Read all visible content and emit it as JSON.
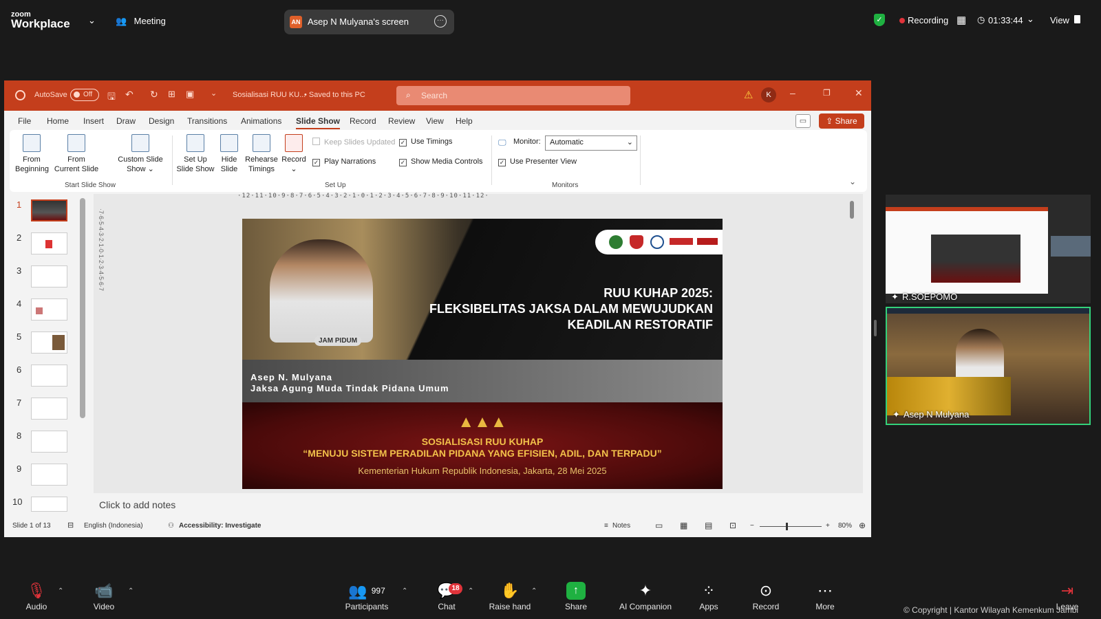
{
  "zoom": {
    "logo_line1": "zoom",
    "logo_line2": "Workplace",
    "meeting_label": "Meeting",
    "screen_share_initials": "AN",
    "screen_share_label": "Asep N Mulyana's screen",
    "recording_label": "Recording",
    "timer": "01:33:44",
    "view_label": "View",
    "accent_green": "#1fb141",
    "record_red": "#e0333a"
  },
  "ppt": {
    "autosave_label": "AutoSave",
    "autosave_state": "Off",
    "file_name": "Sosialisasi RUU KU...",
    "saved_state": "• Saved to this PC",
    "search_placeholder": "Search",
    "user_initial": "K",
    "share_label": "Share",
    "tabs": [
      "File",
      "Home",
      "Insert",
      "Draw",
      "Design",
      "Transitions",
      "Animations",
      "Slide Show",
      "Record",
      "Review",
      "View",
      "Help"
    ],
    "active_tab": "Slide Show",
    "ribbon": {
      "from_beginning": [
        "From",
        "Beginning"
      ],
      "from_current": [
        "From",
        "Current Slide"
      ],
      "custom_show": [
        "Custom Slide",
        "Show"
      ],
      "setup_show": [
        "Set Up",
        "Slide Show"
      ],
      "hide_slide": [
        "Hide",
        "Slide"
      ],
      "rehearse": [
        "Rehearse",
        "Timings"
      ],
      "record": "Record",
      "keep_slides_updated": "Keep Slides Updated",
      "use_timings": "Use Timings",
      "play_narrations": "Play Narrations",
      "show_media_controls": "Show Media Controls",
      "monitor_label": "Monitor:",
      "monitor_value": "Automatic",
      "use_presenter_view": "Use Presenter View",
      "group_start": "Start Slide Show",
      "group_setup": "Set Up",
      "group_monitors": "Monitors"
    },
    "thumbnail_numbers": [
      "1",
      "2",
      "3",
      "4",
      "5",
      "6",
      "7",
      "8",
      "9",
      "10"
    ],
    "ruler_text": "·12·11·10·9·8·7·6·5·4·3·2·1·0·1·2·3·4·5·6·7·8·9·10·11·12·",
    "notes_placeholder": "Click to add notes",
    "status": {
      "slide_counter": "Slide 1 of 13",
      "language": "English (Indonesia)",
      "accessibility": "Accessibility: Investigate",
      "notes_label": "Notes",
      "zoom_level": "80%"
    }
  },
  "slide": {
    "badge": "JAM PIDUM",
    "title_line1": "RUU KUHAP 2025:",
    "title_line2": "FLEKSIBELITAS JAKSA DALAM MEWUJUDKAN",
    "title_line3": "KEADILAN RESTORATIF",
    "speaker_name": "Asep N. Mulyana",
    "speaker_role": "Jaksa Agung Muda Tindak Pidana Umum",
    "stars": "▲▲▲",
    "event_line1": "SOSIALISASI RUU KUHAP",
    "event_line2": "“MENUJU SISTEM PERADILAN PIDANA YANG EFISIEN, ADIL, DAN TERPADU”",
    "event_line3": "Kementerian Hukum Republik Indonesia, Jakarta, 28 Mei 2025"
  },
  "participants_panel": {
    "tile1_name": "R.SOEPOMO",
    "tile2_name": "Asep N Mulyana"
  },
  "toolbar": {
    "audio": "Audio",
    "video": "Video",
    "participants": "Participants",
    "participant_count": "997",
    "chat": "Chat",
    "chat_badge": "18",
    "raise_hand": "Raise hand",
    "share": "Share",
    "ai_companion": "AI Companion",
    "apps": "Apps",
    "record": "Record",
    "more": "More",
    "leave": "Leave"
  },
  "copyright": "© Copyright | Kantor Wilayah Kemenkum Jambi"
}
